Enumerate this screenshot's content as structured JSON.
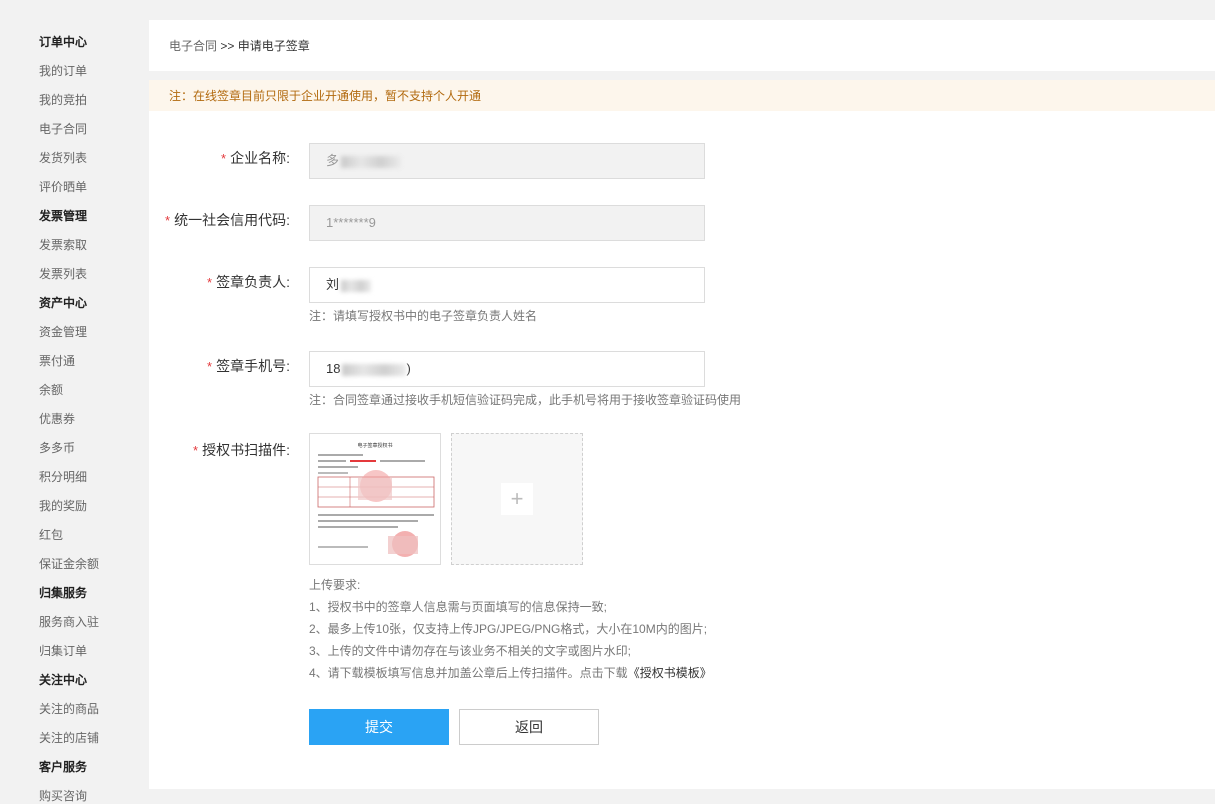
{
  "sidebar": {
    "items": [
      {
        "label": "订单中心",
        "head": true
      },
      {
        "label": "我的订单"
      },
      {
        "label": "我的竞拍"
      },
      {
        "label": "电子合同"
      },
      {
        "label": "发货列表"
      },
      {
        "label": "评价晒单"
      },
      {
        "label": "发票管理",
        "head": true
      },
      {
        "label": "发票索取"
      },
      {
        "label": "发票列表"
      },
      {
        "label": "资产中心",
        "head": true
      },
      {
        "label": "资金管理"
      },
      {
        "label": "票付通"
      },
      {
        "label": "余额"
      },
      {
        "label": "优惠券"
      },
      {
        "label": "多多币"
      },
      {
        "label": "积分明细"
      },
      {
        "label": "我的奖励"
      },
      {
        "label": "红包"
      },
      {
        "label": "保证金余额"
      },
      {
        "label": "归集服务",
        "head": true
      },
      {
        "label": "服务商入驻"
      },
      {
        "label": "归集订单"
      },
      {
        "label": "关注中心",
        "head": true
      },
      {
        "label": "关注的商品"
      },
      {
        "label": "关注的店铺"
      },
      {
        "label": "客户服务",
        "head": true
      },
      {
        "label": "购买咨询"
      }
    ]
  },
  "breadcrumb": {
    "parent": "电子合同",
    "separator": ">>",
    "current": "申请电子签章"
  },
  "notice": "注：在线签章目前只限于企业开通使用，暂不支持个人开通",
  "form": {
    "required_mark": "*",
    "company": {
      "label": "企业名称:",
      "value": "多"
    },
    "credit_code": {
      "label": "统一社会信用代码:",
      "value": "1*******9"
    },
    "signer": {
      "label": "签章负责人:",
      "value": "刘",
      "hint": "注：请填写授权书中的电子签章负责人姓名"
    },
    "phone": {
      "label": "签章手机号:",
      "value": "18",
      "value_tail": ")",
      "hint": "注：合同签章通过接收手机短信验证码完成，此手机号将用于接收签章验证码使用"
    },
    "auth": {
      "label": "授权书扫描件:",
      "thumb_title": "电子签章授权书",
      "upload_icon": "+"
    }
  },
  "requirements": {
    "title": "上传要求:",
    "items": [
      "1、授权书中的签章人信息需与页面填写的信息保持一致;",
      "2、最多上传10张，仅支持上传JPG/JPEG/PNG格式，大小在10M内的图片;",
      "3、上传的文件中请勿存在与该业务不相关的文字或图片水印;",
      "4、请下载模板填写信息并加盖公章后上传扫描件。点击下载"
    ],
    "download_link": "《授权书模板》"
  },
  "buttons": {
    "submit": "提交",
    "back": "返回"
  },
  "colors": {
    "primary": "#2aa3f4",
    "required": "#e4393c",
    "notice_bg": "#fdf6ec",
    "notice_text": "#b26a0f"
  }
}
